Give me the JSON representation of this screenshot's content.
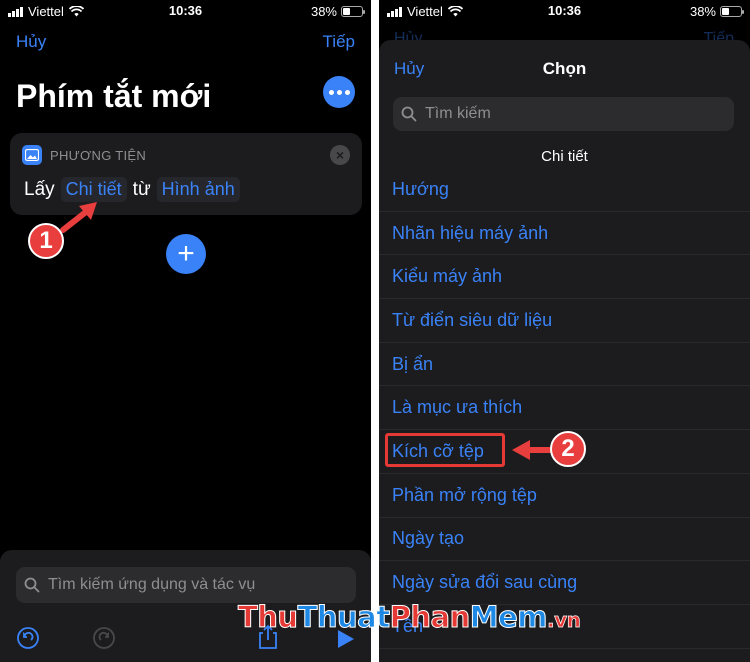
{
  "left": {
    "status": {
      "carrier": "Viettel",
      "time": "10:36",
      "battery": "38%"
    },
    "nav": {
      "cancel": "Hủy",
      "next": "Tiếp"
    },
    "title": "Phím tắt mới",
    "action": {
      "category": "PHƯƠNG TIỆN",
      "get": "Lấy",
      "detail_token": "Chi tiết",
      "from": "từ",
      "source_token": "Hình ảnh"
    },
    "callout": "1",
    "search_placeholder": "Tìm kiếm ứng dụng và tác vụ"
  },
  "right": {
    "status": {
      "carrier": "Viettel",
      "time": "10:36",
      "battery": "38%"
    },
    "peek": {
      "cancel": "Hủy",
      "next": "Tiếp"
    },
    "nav": {
      "cancel": "Hủy",
      "title": "Chọn"
    },
    "search_placeholder": "Tìm kiếm",
    "section_header": "Chi tiết",
    "options": [
      "Hướng",
      "Nhãn hiệu máy ảnh",
      "Kiểu máy ảnh",
      "Từ điển siêu dữ liệu",
      "Bị ẩn",
      "Là mục ưa thích",
      "Kích cỡ tệp",
      "Phần mở rộng tệp",
      "Ngày tạo",
      "Ngày sửa đổi sau cùng",
      "Tên"
    ],
    "selected_option": "Kích cỡ tệp",
    "callout": "2"
  },
  "watermark": {
    "part1": "Thu",
    "part2": "Thuat",
    "part3": "Phan",
    "part4": "Mem",
    "part5": ".vn"
  },
  "colors": {
    "accent": "#3a82f7",
    "callout": "#e83e3e",
    "background": "#000000",
    "surface": "#1c1c1e"
  },
  "icons": [
    "wifi-icon",
    "media-icon",
    "close-icon",
    "more-icon",
    "plus-icon",
    "search-icon",
    "undo-icon",
    "redo-icon",
    "share-icon",
    "play-icon"
  ]
}
